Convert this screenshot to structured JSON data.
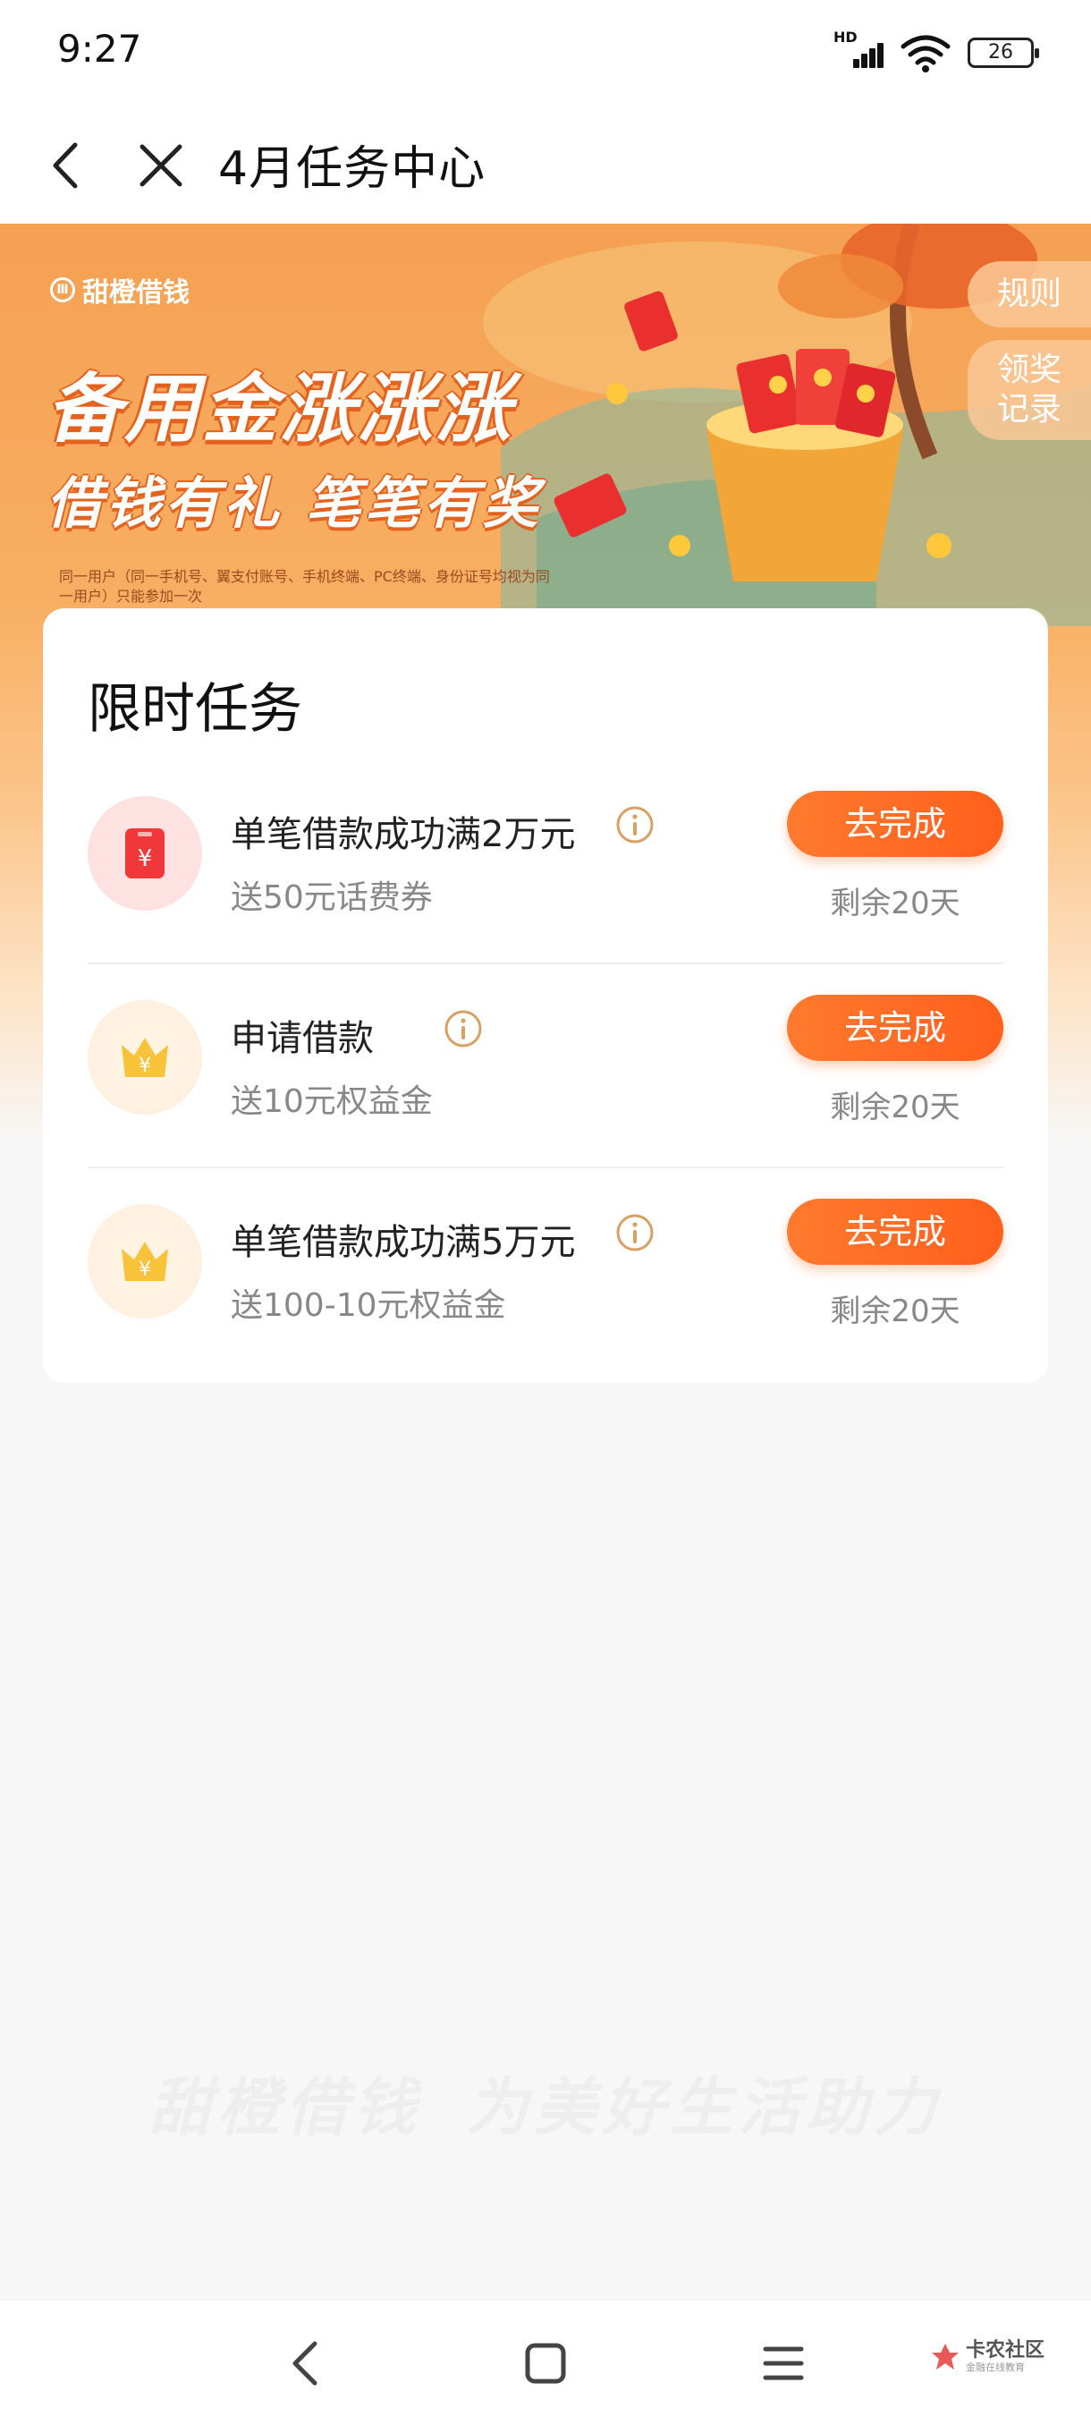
{
  "status": {
    "time": "9:27",
    "battery": "26",
    "network_label": "HD"
  },
  "header": {
    "title": "4月任务中心"
  },
  "banner": {
    "brand": "甜橙借钱",
    "headline": "备用金涨涨涨",
    "subline": "借钱有礼 笔笔有奖",
    "note": "同一用户（同一手机号、翼支付账号、手机终端、PC终端、身份证号均视为同一用户）只能参加一次",
    "rules_label": "规则",
    "records_label_line1": "领奖",
    "records_label_line2": "记录"
  },
  "tasks_section": {
    "title": "限时任务",
    "items": [
      {
        "title": "单笔借款成功满2万元",
        "reward": "送50元话费券",
        "button": "去完成",
        "remaining": "剩余20天",
        "icon": "red-phone-coupon-icon"
      },
      {
        "title": "申请借款",
        "reward": "送10元权益金",
        "button": "去完成",
        "remaining": "剩余20天",
        "icon": "gold-crown-yuan-icon"
      },
      {
        "title": "单笔借款成功满5万元",
        "reward": "送100-10元权益金",
        "button": "去完成",
        "remaining": "剩余20天",
        "icon": "gold-crown-yuan-icon"
      }
    ]
  },
  "footer": {
    "slogan": "甜橙借钱 为美好生活助力"
  },
  "watermark": {
    "text": "卡农社区",
    "sub": "金融在线教育"
  },
  "colors": {
    "accent": "#ff6a22",
    "banner": "#f5a052",
    "icon_red": "#f0383a",
    "icon_gold": "#f8c23a"
  }
}
